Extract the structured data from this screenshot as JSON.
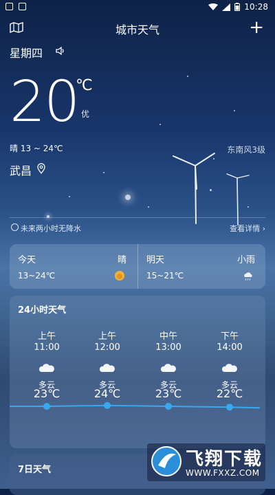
{
  "status_bar": {
    "time": "10:28"
  },
  "app_bar": {
    "title": "城市天气"
  },
  "current": {
    "weekday": "星期四",
    "temperature": "20",
    "unit": "℃",
    "aqi": "优",
    "range": "晴 13 ~ 24℃",
    "wind": "东南风3级",
    "city": "武昌",
    "precip_notice": "未来两小时无降水",
    "detail_link": "查看详情 ›"
  },
  "daily": [
    {
      "name": "今天",
      "condition": "晴",
      "range": "13~24℃",
      "icon": "sun-icon"
    },
    {
      "name": "明天",
      "condition": "小雨",
      "range": "15~21℃",
      "icon": "rain-icon"
    }
  ],
  "hourly": {
    "title": "24小时天气",
    "items": [
      {
        "period": "上午",
        "time": "11:00",
        "condition": "多云",
        "temp": "23℃",
        "icon": "cloud-icon"
      },
      {
        "period": "上午",
        "time": "12:00",
        "condition": "多云",
        "temp": "24℃",
        "icon": "cloud-icon"
      },
      {
        "period": "中午",
        "time": "13:00",
        "condition": "多云",
        "temp": "23℃",
        "icon": "cloud-icon"
      },
      {
        "period": "下午",
        "time": "14:00",
        "condition": "多云",
        "temp": "22℃",
        "icon": "cloud-icon"
      }
    ]
  },
  "weekly": {
    "title": "7日天气"
  },
  "watermark": {
    "text": "飞翔下载",
    "url": "WWW.FXXZ.COM"
  },
  "colors": {
    "line": "#3aa8f0",
    "sun": "#f2b233"
  }
}
